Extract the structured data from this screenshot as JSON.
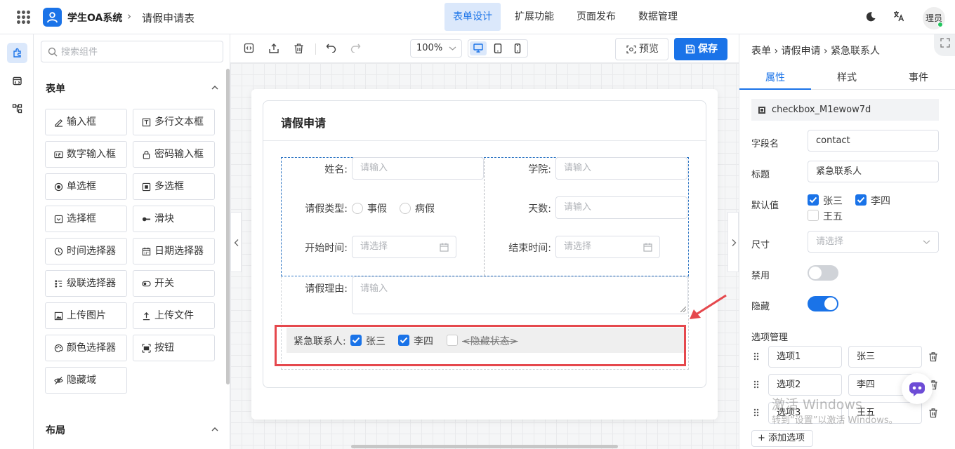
{
  "app": {
    "title": "学生OA系统",
    "breadcrumb_sep": "›",
    "page": "请假申请表"
  },
  "topnav": [
    {
      "label": "表单设计",
      "active": true
    },
    {
      "label": "扩展功能",
      "active": false
    },
    {
      "label": "页面发布",
      "active": false
    },
    {
      "label": "数据管理",
      "active": false
    }
  ],
  "user": {
    "avatar": "理员",
    "status_color": "#22c55e"
  },
  "components": {
    "search_placeholder": "搜索组件",
    "section_form": "表单",
    "section_layout": "布局",
    "items": [
      {
        "label": "输入框",
        "icon": "edit-icon"
      },
      {
        "label": "多行文本框",
        "icon": "textarea-icon"
      },
      {
        "label": "数字输入框",
        "icon": "number-icon"
      },
      {
        "label": "密码输入框",
        "icon": "lock-icon"
      },
      {
        "label": "单选框",
        "icon": "radio-icon"
      },
      {
        "label": "多选框",
        "icon": "checkbox-icon"
      },
      {
        "label": "选择框",
        "icon": "select-icon"
      },
      {
        "label": "滑块",
        "icon": "slider-icon"
      },
      {
        "label": "时间选择器",
        "icon": "clock-icon"
      },
      {
        "label": "日期选择器",
        "icon": "calendar-icon"
      },
      {
        "label": "级联选择器",
        "icon": "cascader-icon"
      },
      {
        "label": "开关",
        "icon": "switch-icon"
      },
      {
        "label": "上传图片",
        "icon": "image-icon"
      },
      {
        "label": "上传文件",
        "icon": "upload-icon"
      },
      {
        "label": "颜色选择器",
        "icon": "palette-icon"
      },
      {
        "label": "按钮",
        "icon": "button-icon"
      },
      {
        "label": "隐藏域",
        "icon": "eye-off-icon"
      }
    ]
  },
  "toolbar": {
    "zoom": "100%",
    "preview": "预览",
    "save": "保存"
  },
  "form": {
    "title": "请假申请",
    "name_label": "姓名:",
    "name_placeholder": "请输入",
    "college_label": "学院:",
    "college_placeholder": "请输入",
    "type_label": "请假类型:",
    "type_options": [
      "事假",
      "病假"
    ],
    "days_label": "天数:",
    "days_placeholder": "请输入",
    "start_label": "开始时间:",
    "start_placeholder": "请选择",
    "end_label": "结束时间:",
    "end_placeholder": "请选择",
    "reason_label": "请假理由:",
    "reason_placeholder": "请输入",
    "contact_label": "紧急联系人:",
    "contact_options": [
      {
        "label": "张三",
        "checked": true
      },
      {
        "label": "李四",
        "checked": true
      }
    ],
    "contact_hidden_text": "<隐藏状态>"
  },
  "props": {
    "breadcrumb": "表单 › 请假申请 › 紧急联系人",
    "tabs": [
      "属性",
      "样式",
      "事件"
    ],
    "active_tab": "属性",
    "component_id": "checkbox_M1ewow7d",
    "field_label": "字段名",
    "field_value": "contact",
    "title_label": "标题",
    "title_value": "紧急联系人",
    "default_label": "默认值",
    "defaults": [
      {
        "label": "张三",
        "checked": true
      },
      {
        "label": "李四",
        "checked": true
      },
      {
        "label": "王五",
        "checked": false
      }
    ],
    "size_label": "尺寸",
    "size_placeholder": "请选择",
    "disabled_label": "禁用",
    "disabled": false,
    "hidden_label": "隐藏",
    "hidden": true,
    "options_label": "选项管理",
    "options": [
      {
        "key": "选项1",
        "value": "张三"
      },
      {
        "key": "选项2",
        "value": "李四"
      },
      {
        "key": "选项3",
        "value": "王五"
      }
    ],
    "add_option": "+ 添加选项"
  },
  "watermark": {
    "line1": "激活 Windows",
    "line2": "转到“设置”以激活 Windows。"
  },
  "colors": {
    "accent": "#1a73e8",
    "annotation": "#e5484d",
    "active_bg": "#dbe8fb"
  }
}
